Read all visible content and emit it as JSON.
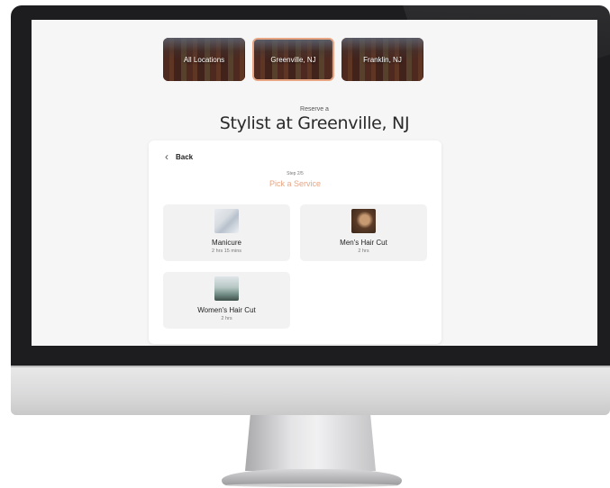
{
  "locations": [
    {
      "label": "All Locations",
      "selected": false
    },
    {
      "label": "Greenville, NJ",
      "selected": true
    },
    {
      "label": "Franklin, NJ",
      "selected": false
    }
  ],
  "heading": {
    "pre": "Reserve a",
    "title": "Stylist at Greenville, NJ"
  },
  "card": {
    "back_label": "Back",
    "step": "Step 2/5",
    "pick": "Pick a Service",
    "services": [
      {
        "name": "Manicure",
        "duration": "2 hrs 15 mins",
        "image": "manicure-photo"
      },
      {
        "name": "Men's Hair Cut",
        "duration": "2 hrs",
        "image": "mens-haircut-photo"
      },
      {
        "name": "Women's Hair Cut",
        "duration": "2 hrs",
        "image": "womens-haircut-photo"
      }
    ]
  },
  "colors": {
    "accent": "#e8a583",
    "screen_bg": "#f6f6f6",
    "tile_bg": "#f2f2f2"
  }
}
